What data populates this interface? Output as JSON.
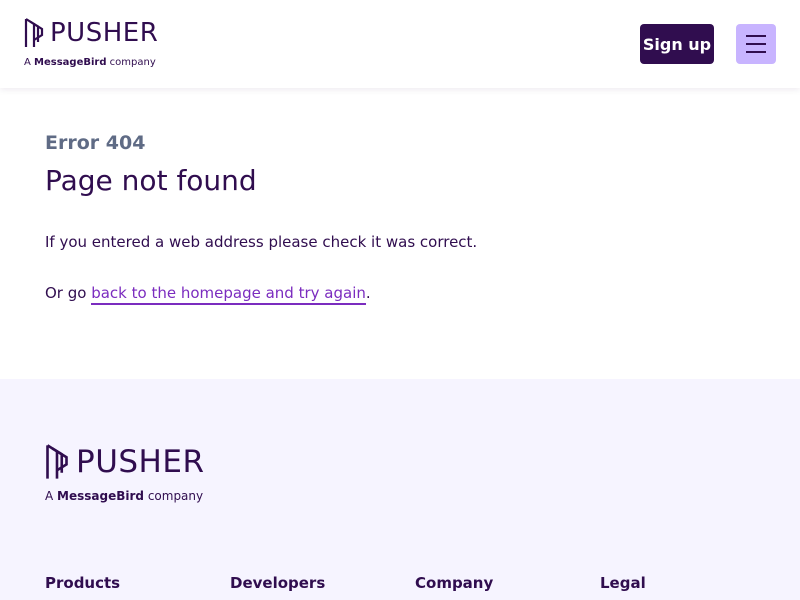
{
  "header": {
    "logo_text": "PUSHER",
    "logo_sub_prefix": "A ",
    "logo_sub_brand": "MessageBird",
    "logo_sub_suffix": " company",
    "signup_label": "Sign up",
    "menu_icon": "hamburger-menu-icon"
  },
  "main": {
    "error_code": "Error 404",
    "title": "Page not found",
    "message": "If you entered a web address please check it was correct.",
    "back_prefix": "Or go ",
    "back_link": "back to the homepage and try again",
    "back_suffix": "."
  },
  "footer": {
    "logo_text": "PUSHER",
    "logo_sub_prefix": "A ",
    "logo_sub_brand": "MessageBird",
    "logo_sub_suffix": " company",
    "columns": [
      "Products",
      "Developers",
      "Company",
      "Legal"
    ]
  },
  "colors": {
    "brand": "#300d4f",
    "accent": "#c8b4ff",
    "link": "#7b2cbf",
    "footer_bg": "#f6f4ff"
  }
}
